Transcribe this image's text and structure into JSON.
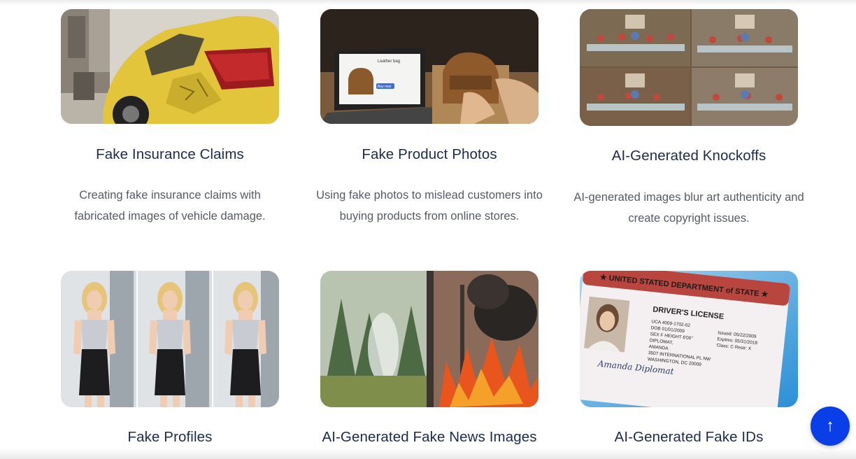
{
  "cards": [
    {
      "title": "Fake Insurance Claims",
      "description": "Creating fake insurance claims with fabricated images of vehicle damage.",
      "image": "damaged-yellow-car"
    },
    {
      "title": "Fake Product Photos",
      "description": "Using fake photos to mislead customers into buying products from online stores.",
      "image": "laptop-leather-bag"
    },
    {
      "title": "AI-Generated Knockoffs",
      "description": "AI-generated images blur art authenticity and create copyright issues.",
      "image": "last-supper-grid"
    },
    {
      "title": "Fake Profiles",
      "image": "woman-portrait-triptych"
    },
    {
      "title": "AI-Generated Fake News Images",
      "image": "forest-fire-split"
    },
    {
      "title": "AI-Generated Fake IDs",
      "image": "drivers-license-card"
    }
  ],
  "id_card": {
    "header": "★ UNITED STATED DEPARTMENT of STATE ★",
    "heading": "DRIVER'S LICENSE",
    "line1": "UCA 4009-1702-02",
    "line2": "DOB 01/01/2009",
    "line3": "SEX F   HEIGHT 6'00\"",
    "line4": "DIPLOMAT,",
    "line5": "AMANDA",
    "line6": "3507 INTERNATIONAL PL NW",
    "line7": "WASHINGTON, DC 20009",
    "issued": "Issued: 05/22/2009",
    "expires": "Expires: 05/31/2018",
    "class": "Class: C    Restr: X",
    "signature": "Amanda Diplomat"
  },
  "product_screen": {
    "title": "Leather bag",
    "button": "Buy now"
  },
  "scroll_top": {
    "label": "↑"
  },
  "colors": {
    "accent": "#0a3ee6",
    "title": "#1c2b4d",
    "body": "#555b66"
  }
}
